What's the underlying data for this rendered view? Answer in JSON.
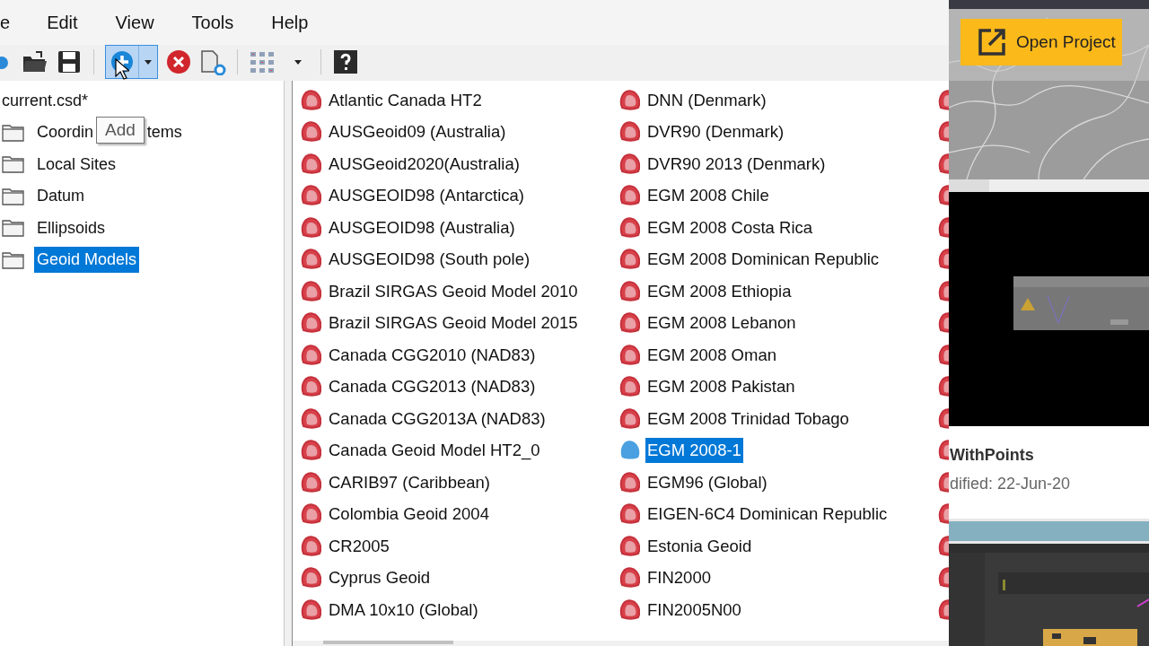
{
  "menu": [
    "e",
    "Edit",
    "View",
    "Tools",
    "Help"
  ],
  "toolbar": [
    {
      "kind": "cut-icon"
    },
    {
      "kind": "open"
    },
    {
      "kind": "save"
    },
    {
      "kind": "sep"
    },
    {
      "kind": "add",
      "selected": true
    },
    {
      "kind": "delete"
    },
    {
      "kind": "copy"
    },
    {
      "kind": "sep"
    },
    {
      "kind": "grid"
    },
    {
      "kind": "sep"
    },
    {
      "kind": "help"
    }
  ],
  "tooltip": "Add",
  "tree": {
    "label": "current.csd*",
    "children": [
      {
        "label": "Coordin",
        "label_after_tooltip": "tems",
        "selected": false
      },
      {
        "label": "Local Sites",
        "selected": false
      },
      {
        "label": "Datum",
        "selected": false
      },
      {
        "label": "Ellipsoids",
        "selected": false
      },
      {
        "label": "Geoid Models",
        "selected": true
      }
    ]
  },
  "list": {
    "columns": [
      [
        {
          "label": "Atlantic Canada HT2",
          "selected": false
        },
        {
          "label": "AUSGeoid09 (Australia)",
          "selected": false
        },
        {
          "label": "AUSGeoid2020(Australia)",
          "selected": false
        },
        {
          "label": "AUSGEOID98 (Antarctica)",
          "selected": false
        },
        {
          "label": "AUSGEOID98 (Australia)",
          "selected": false
        },
        {
          "label": "AUSGEOID98 (South pole)",
          "selected": false
        },
        {
          "label": "Brazil SIRGAS Geoid Model 2010",
          "selected": false
        },
        {
          "label": "Brazil SIRGAS Geoid Model 2015",
          "selected": false
        },
        {
          "label": "Canada CGG2010 (NAD83)",
          "selected": false
        },
        {
          "label": "Canada CGG2013 (NAD83)",
          "selected": false
        },
        {
          "label": "Canada CGG2013A (NAD83)",
          "selected": false
        },
        {
          "label": "Canada Geoid Model HT2_0",
          "selected": false
        },
        {
          "label": "CARIB97 (Caribbean)",
          "selected": false
        },
        {
          "label": "Colombia Geoid 2004",
          "selected": false
        },
        {
          "label": "CR2005",
          "selected": false
        },
        {
          "label": "Cyprus Geoid",
          "selected": false
        },
        {
          "label": "DMA 10x10 (Global)",
          "selected": false
        }
      ],
      [
        {
          "label": "DNN (Denmark)",
          "selected": false
        },
        {
          "label": "DVR90 (Denmark)",
          "selected": false
        },
        {
          "label": "DVR90 2013 (Denmark)",
          "selected": false
        },
        {
          "label": "EGM 2008 Chile",
          "selected": false
        },
        {
          "label": "EGM 2008 Costa Rica",
          "selected": false
        },
        {
          "label": "EGM 2008 Dominican Republic",
          "selected": false
        },
        {
          "label": "EGM 2008 Ethiopia",
          "selected": false
        },
        {
          "label": "EGM 2008 Lebanon",
          "selected": false
        },
        {
          "label": "EGM 2008 Oman",
          "selected": false
        },
        {
          "label": "EGM 2008 Pakistan",
          "selected": false
        },
        {
          "label": "EGM 2008 Trinidad Tobago",
          "selected": false
        },
        {
          "label": "EGM 2008-1",
          "selected": true
        },
        {
          "label": "EGM96 (Global)",
          "selected": false
        },
        {
          "label": "EIGEN-6C4 Dominican Republic",
          "selected": false
        },
        {
          "label": "Estonia Geoid",
          "selected": false
        },
        {
          "label": "FIN2000",
          "selected": false
        },
        {
          "label": "FIN2005N00",
          "selected": false
        }
      ]
    ],
    "cut_column": [
      {
        "selected": false
      },
      {
        "selected": false
      },
      {
        "selected": false
      },
      {
        "selected": false
      },
      {
        "selected": false
      },
      {
        "selected": false
      },
      {
        "selected": false
      },
      {
        "selected": false
      },
      {
        "selected": false
      },
      {
        "selected": false
      },
      {
        "selected": false
      },
      {
        "selected": false
      },
      {
        "selected": false
      },
      {
        "selected": false
      },
      {
        "selected": false
      },
      {
        "selected": false
      },
      {
        "selected": false
      }
    ]
  },
  "side": {
    "button": "Open Project",
    "title": "WithPoints",
    "modified": "dified: 22-Jun-20"
  }
}
